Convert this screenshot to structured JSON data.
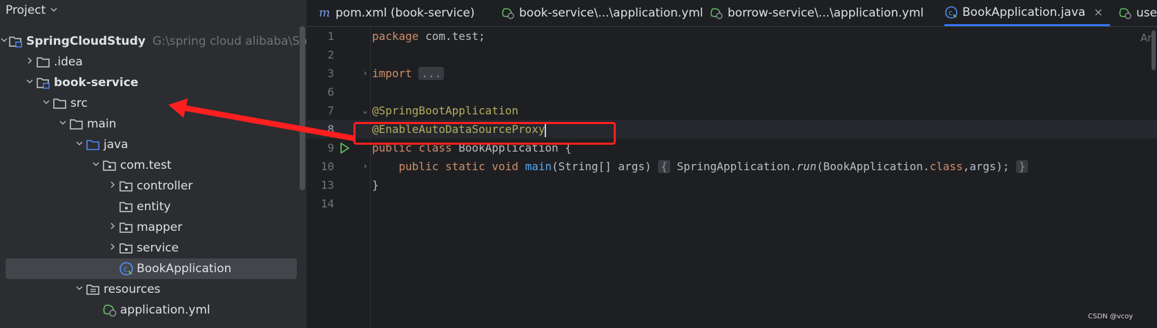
{
  "project_panel": {
    "title": "Project",
    "tree": [
      {
        "label": "SpringCloudStudy",
        "path": "G:\\spring cloud alibaba\\Sprin",
        "arrow": "open",
        "icon": "module-folder-icon",
        "bold": true
      },
      {
        "label": ".idea",
        "arrow": "closed",
        "icon": "folder-icon"
      },
      {
        "label": "book-service",
        "arrow": "open",
        "icon": "module-folder-icon",
        "bold": true
      },
      {
        "label": "src",
        "arrow": "open",
        "icon": "folder-icon"
      },
      {
        "label": "main",
        "arrow": "open",
        "icon": "folder-icon"
      },
      {
        "label": "java",
        "arrow": "open",
        "icon": "source-folder-icon"
      },
      {
        "label": "com.test",
        "arrow": "open",
        "icon": "package-icon"
      },
      {
        "label": "controller",
        "arrow": "closed",
        "icon": "package-icon"
      },
      {
        "label": "entity",
        "arrow": "none",
        "icon": "package-icon"
      },
      {
        "label": "mapper",
        "arrow": "closed",
        "icon": "package-icon"
      },
      {
        "label": "service",
        "arrow": "closed",
        "icon": "package-icon"
      },
      {
        "label": "BookApplication",
        "arrow": "none",
        "icon": "spring-class-icon",
        "selected": true
      },
      {
        "label": "resources",
        "arrow": "open",
        "icon": "resources-folder-icon"
      },
      {
        "label": "application.yml",
        "arrow": "none",
        "icon": "spring-yaml-icon"
      }
    ]
  },
  "tabs": [
    {
      "label": "pom.xml (book-service)",
      "icon": "maven-icon"
    },
    {
      "label": "book-service\\...\\application.yml",
      "icon": "spring-yaml-icon"
    },
    {
      "label": "borrow-service\\...\\application.yml",
      "icon": "spring-yaml-icon"
    },
    {
      "label": "BookApplication.java",
      "icon": "spring-class-icon",
      "active": true,
      "close": "×"
    },
    {
      "label": "use",
      "icon": "spring-yaml-icon"
    }
  ],
  "editor": {
    "line_numbers": [
      "1",
      "2",
      "3",
      "6",
      "7",
      "8",
      "9",
      "10",
      "13",
      "14"
    ],
    "code": {
      "l1_kw": "package",
      "l1_rest": " com.test;",
      "l3_kw": "import",
      "l3_fold": "...",
      "l7_ann": "@SpringBootApplication",
      "l8_ann": "@EnableAutoDataSourceProxy",
      "l9_kw": "public class",
      "l9_rest": " BookApplication {",
      "l10_kw": "public static void",
      "l10_fn": "main",
      "l10_params": "(String[] args)",
      "l10_fold_open": "{",
      "l10_call": " SpringApplication.",
      "l10_run": "run",
      "l10_arg": "(BookApplication.",
      "l10_class_kw": "class",
      "l10_end": ",args); ",
      "l10_fold_close": "}",
      "l13": "}"
    },
    "right_edge_text": "Ar"
  },
  "watermark": "CSDN @vcoy",
  "colors": {
    "highlight_box": "#ff1f1f",
    "active_tab_underline": "#3574f0"
  }
}
